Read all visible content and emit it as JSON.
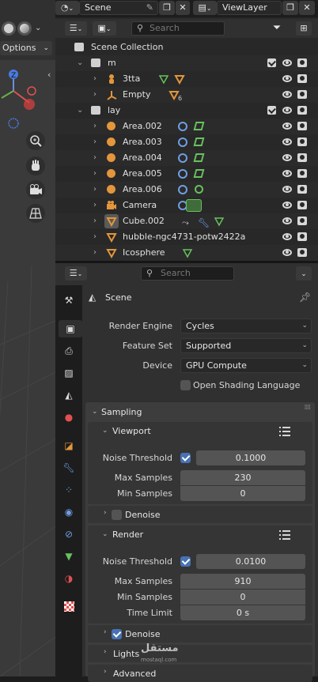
{
  "viewport": {
    "options_label": "Options"
  },
  "outliner": {
    "scene_name": "Scene",
    "viewlayer_name": "ViewLayer",
    "search_placeholder": "Search",
    "root_label": "Scene Collection",
    "rows": [
      {
        "label": "m",
        "kind": "collection"
      },
      {
        "label": "3tta",
        "kind": "object"
      },
      {
        "label": "Empty",
        "kind": "empty",
        "badge": "6"
      },
      {
        "label": "lay",
        "kind": "collection"
      },
      {
        "label": "Area.002",
        "kind": "light"
      },
      {
        "label": "Area.003",
        "kind": "light"
      },
      {
        "label": "Area.004",
        "kind": "light"
      },
      {
        "label": "Area.005",
        "kind": "light"
      },
      {
        "label": "Area.006",
        "kind": "light"
      },
      {
        "label": "Camera",
        "kind": "camera"
      },
      {
        "label": "Cube.002",
        "kind": "mesh"
      },
      {
        "label": "hubble-ngc4731-potw2422a",
        "kind": "mesh"
      },
      {
        "label": "Icosphere",
        "kind": "mesh"
      }
    ]
  },
  "properties": {
    "search_placeholder": "Search",
    "context_label": "Scene",
    "render_engine_label": "Render Engine",
    "render_engine_value": "Cycles",
    "feature_set_label": "Feature Set",
    "feature_set_value": "Supported",
    "device_label": "Device",
    "device_value": "GPU Compute",
    "osl_label": "Open Shading Language",
    "sampling_label": "Sampling",
    "viewport_label": "Viewport",
    "vp_noise_threshold_label": "Noise Threshold",
    "vp_noise_threshold_value": "0.1000",
    "vp_max_samples_label": "Max Samples",
    "vp_max_samples_value": "230",
    "vp_min_samples_label": "Min Samples",
    "vp_min_samples_value": "0",
    "vp_denoise_label": "Denoise",
    "render_label": "Render",
    "r_noise_threshold_label": "Noise Threshold",
    "r_noise_threshold_value": "0.0100",
    "r_max_samples_label": "Max Samples",
    "r_max_samples_value": "910",
    "r_min_samples_label": "Min Samples",
    "r_min_samples_value": "0",
    "r_time_limit_label": "Time Limit",
    "r_time_limit_value": "0 s",
    "r_denoise_label": "Denoise",
    "lights_label": "Lights",
    "advanced_label": "Advanced"
  },
  "watermark": {
    "arabic": "مستقل",
    "latin": "mostaql.com"
  },
  "colors": {
    "accent_blue": "#4772b3",
    "object_orange": "#e3963c",
    "mesh_green": "#67c25e",
    "light_blue": "#6f9ee3"
  }
}
